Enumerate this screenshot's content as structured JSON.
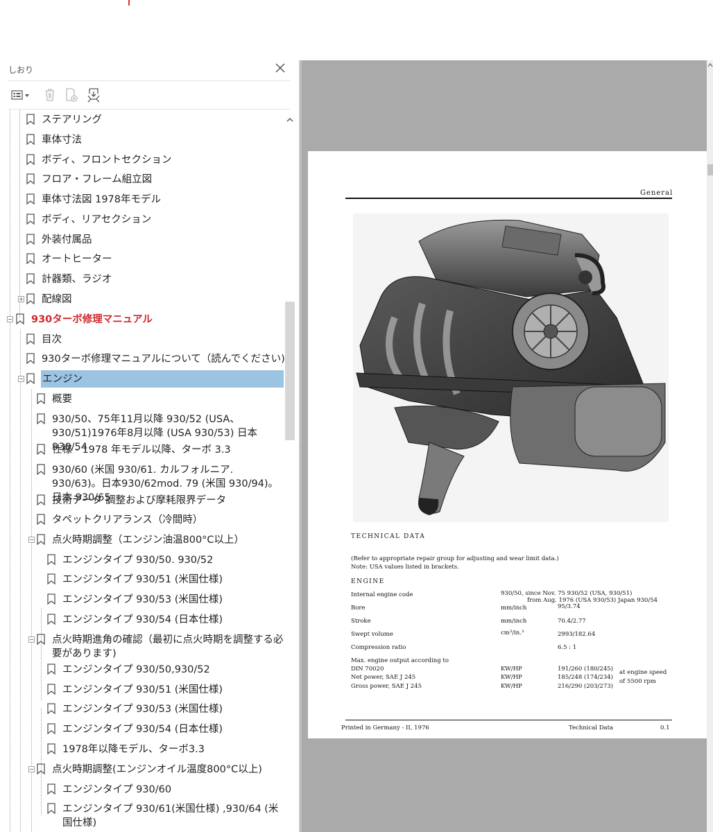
{
  "bookmarks_panel": {
    "title": "しおり",
    "toolbar": {
      "options_icon": "list-options-icon",
      "delete_icon": "trash-icon",
      "new_bookmark_icon": "new-bookmark-icon",
      "expand_icon": "expand-bookmark-icon"
    },
    "items": [
      {
        "label": "ステアリング"
      },
      {
        "label": "車体寸法"
      },
      {
        "label": "ボディ、フロントセクション"
      },
      {
        "label": "フロア・フレーム組立図"
      },
      {
        "label": "車体寸法図  1978年モデル"
      },
      {
        "label": "ボディ、リアセクション"
      },
      {
        "label": "外装付属品"
      },
      {
        "label": "オートヒーター"
      },
      {
        "label": "計器類、ラジオ"
      },
      {
        "label": "配線図"
      },
      {
        "label": "930ターボ修理マニュアル"
      },
      {
        "label": "目次"
      },
      {
        "label": "930ターボ修理マニュアルについて（読んでください)"
      },
      {
        "label": "エンジン"
      },
      {
        "label": "概要"
      },
      {
        "label": "930/50、75年11月以降 930/52 (USA、930/51)1976年8月以降 (USA 930/53) 日本 930/54"
      },
      {
        "label": "仕様 - 1978 年モデル以降、ターボ 3.3"
      },
      {
        "label": "930/60 (米国 930/61. カルフォルニア. 930/63)。日本930/62mod. 79 (米国 930/94)。日本 930/65"
      },
      {
        "label": "技術データ 調整および摩耗限界データ"
      },
      {
        "label": "タペットクリアランス（冷間時）"
      },
      {
        "label": "点火時期調整（エンジン油温800°C以上）"
      },
      {
        "label": "エンジンタイプ 930/50. 930/52"
      },
      {
        "label": "エンジンタイプ 930/51 (米国仕様)"
      },
      {
        "label": "エンジンタイプ 930/53 (米国仕様)"
      },
      {
        "label": "エンジンタイプ 930/54 (日本仕様)"
      },
      {
        "label": "点火時期進角の確認（最初に点火時期を調整する必要があります)"
      },
      {
        "label": "エンジンタイプ 930/50,930/52"
      },
      {
        "label": "エンジンタイプ 930/51 (米国仕様)"
      },
      {
        "label": "エンジンタイプ 930/53 (米国仕様)"
      },
      {
        "label": "エンジンタイプ 930/54  (日本仕様)"
      },
      {
        "label": "1978年以降モデル、ターボ3.3"
      },
      {
        "label": "点火時期調整(エンジンオイル温度800°C以上)"
      },
      {
        "label": "エンジンタイプ 930/60"
      },
      {
        "label": "エンジンタイプ 930/61(米国仕様) ,930/64 (米国仕様)"
      }
    ],
    "selected_label": "エンジン",
    "highlight_color": "#9bc3e2",
    "accent_red": "#d0262a"
  },
  "document_page": {
    "header": "General",
    "section_title": "TECHNICAL DATA",
    "note1": "(Refer to appropriate repair group for adjusting and wear limit data.)",
    "note2": "Note: USA values listed in brackets.",
    "engine_heading": "ENGINE",
    "specs": {
      "code_label": "Internal engine code",
      "code_value_1": "930/50, since Nov. 75  930/52 (USA, 930/51)",
      "code_value_2": "from Aug. 1976 (USA 930/53) Japan 930/54",
      "bore_label": "Bore",
      "bore_unit": "mm/inch",
      "bore_value": "95/3.74",
      "stroke_label": "Stroke",
      "stroke_unit": "mm/inch",
      "stroke_value": "70.4/2.77",
      "swept_label": "Swept volume",
      "swept_unit": "cm³/in.³",
      "swept_value": "2993/182.64",
      "compression_label": "Compression ratio",
      "compression_value": "6.5 : 1",
      "output_label_1": "Max. engine output according to",
      "output_label_2": "DIN 70020",
      "output_unit_1": "KW/HP",
      "output_value_1": "191/260 (180/245)",
      "net_label": "Net power,  SAE J 245",
      "output_unit_2": "KW/HP",
      "output_value_2": "185/248 (174/234)",
      "gross_label": "Gross power,  SAE J 245",
      "output_unit_3": "KW/HP",
      "output_value_3": "216/290 (203/273)",
      "speed_note_1": "at engine speed",
      "speed_note_2": "of 5500 rpm"
    },
    "footer_left": "Printed in Germany  -  II, 1976",
    "footer_center": "Technical Data",
    "footer_right": "0.1"
  }
}
